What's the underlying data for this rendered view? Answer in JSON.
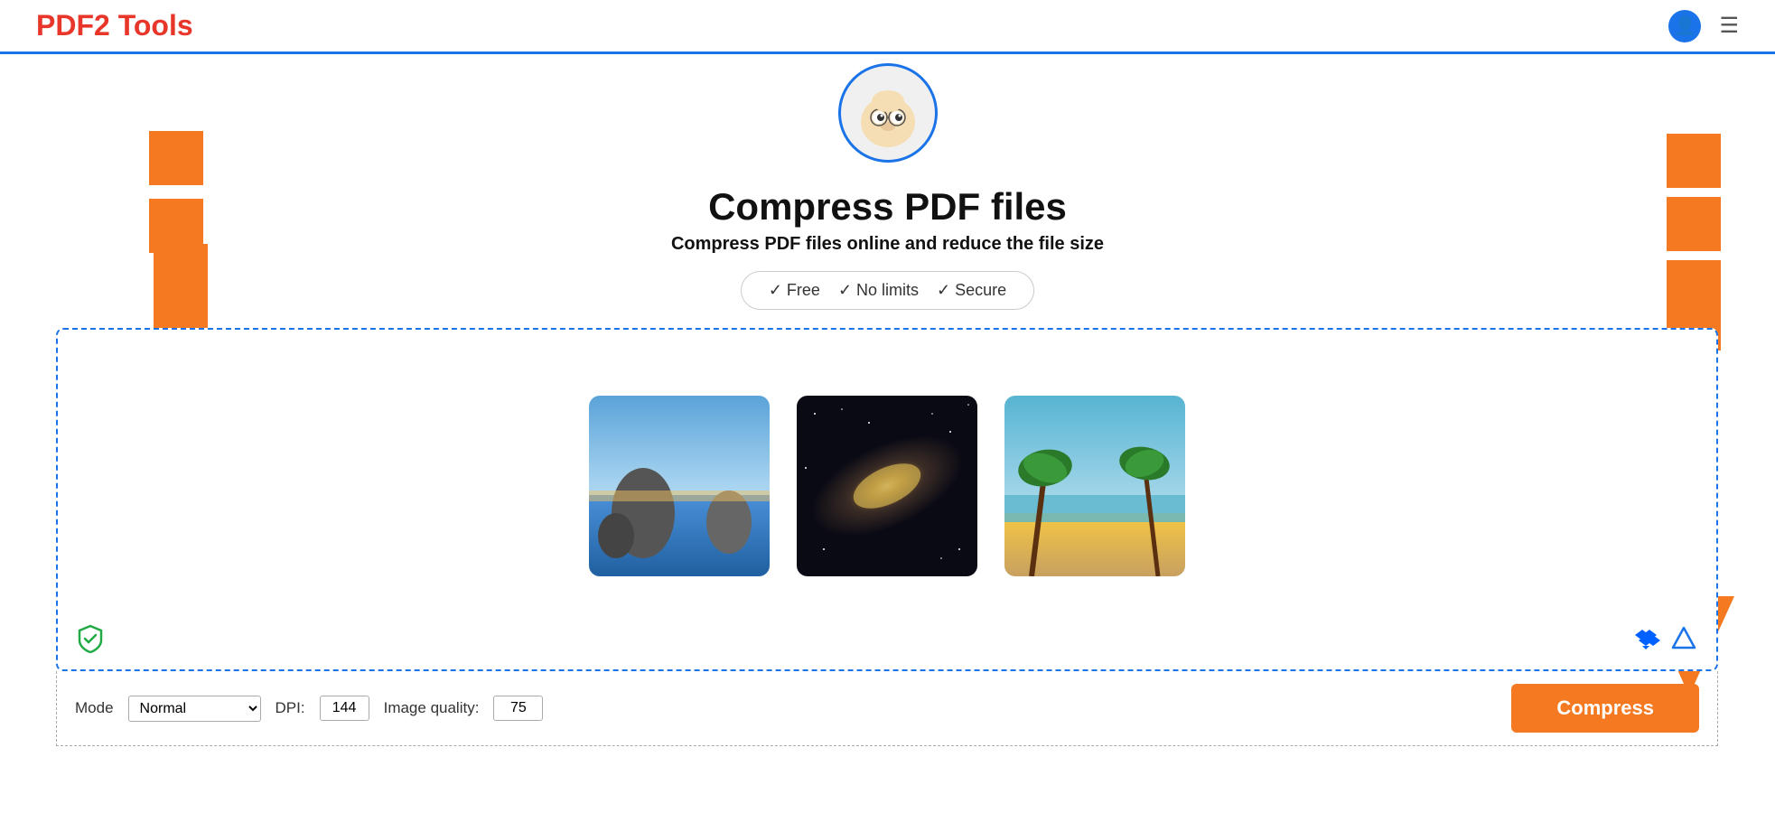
{
  "header": {
    "logo_text": "PDF",
    "logo_tools": " Tools",
    "menu_icon": "☰"
  },
  "page": {
    "title": "Compress PDF files",
    "subtitle": "Compress PDF files online and reduce the file size",
    "badges": {
      "free": "✓ Free",
      "no_limits": "✓ No limits",
      "secure": "✓ Secure"
    }
  },
  "dropzone": {
    "thumbnails": [
      {
        "alt": "beach-rocks"
      },
      {
        "alt": "galaxy"
      },
      {
        "alt": "tropical-beach"
      }
    ]
  },
  "controls": {
    "mode_label": "Mode",
    "mode_value": "Normal",
    "dpi_label": "DPI:",
    "dpi_value": "144",
    "quality_label": "Image quality:",
    "quality_value": "75",
    "compress_label": "Compress"
  },
  "icons": {
    "security": "🛡️",
    "dropbox": "⬡",
    "gdrive": "△"
  }
}
